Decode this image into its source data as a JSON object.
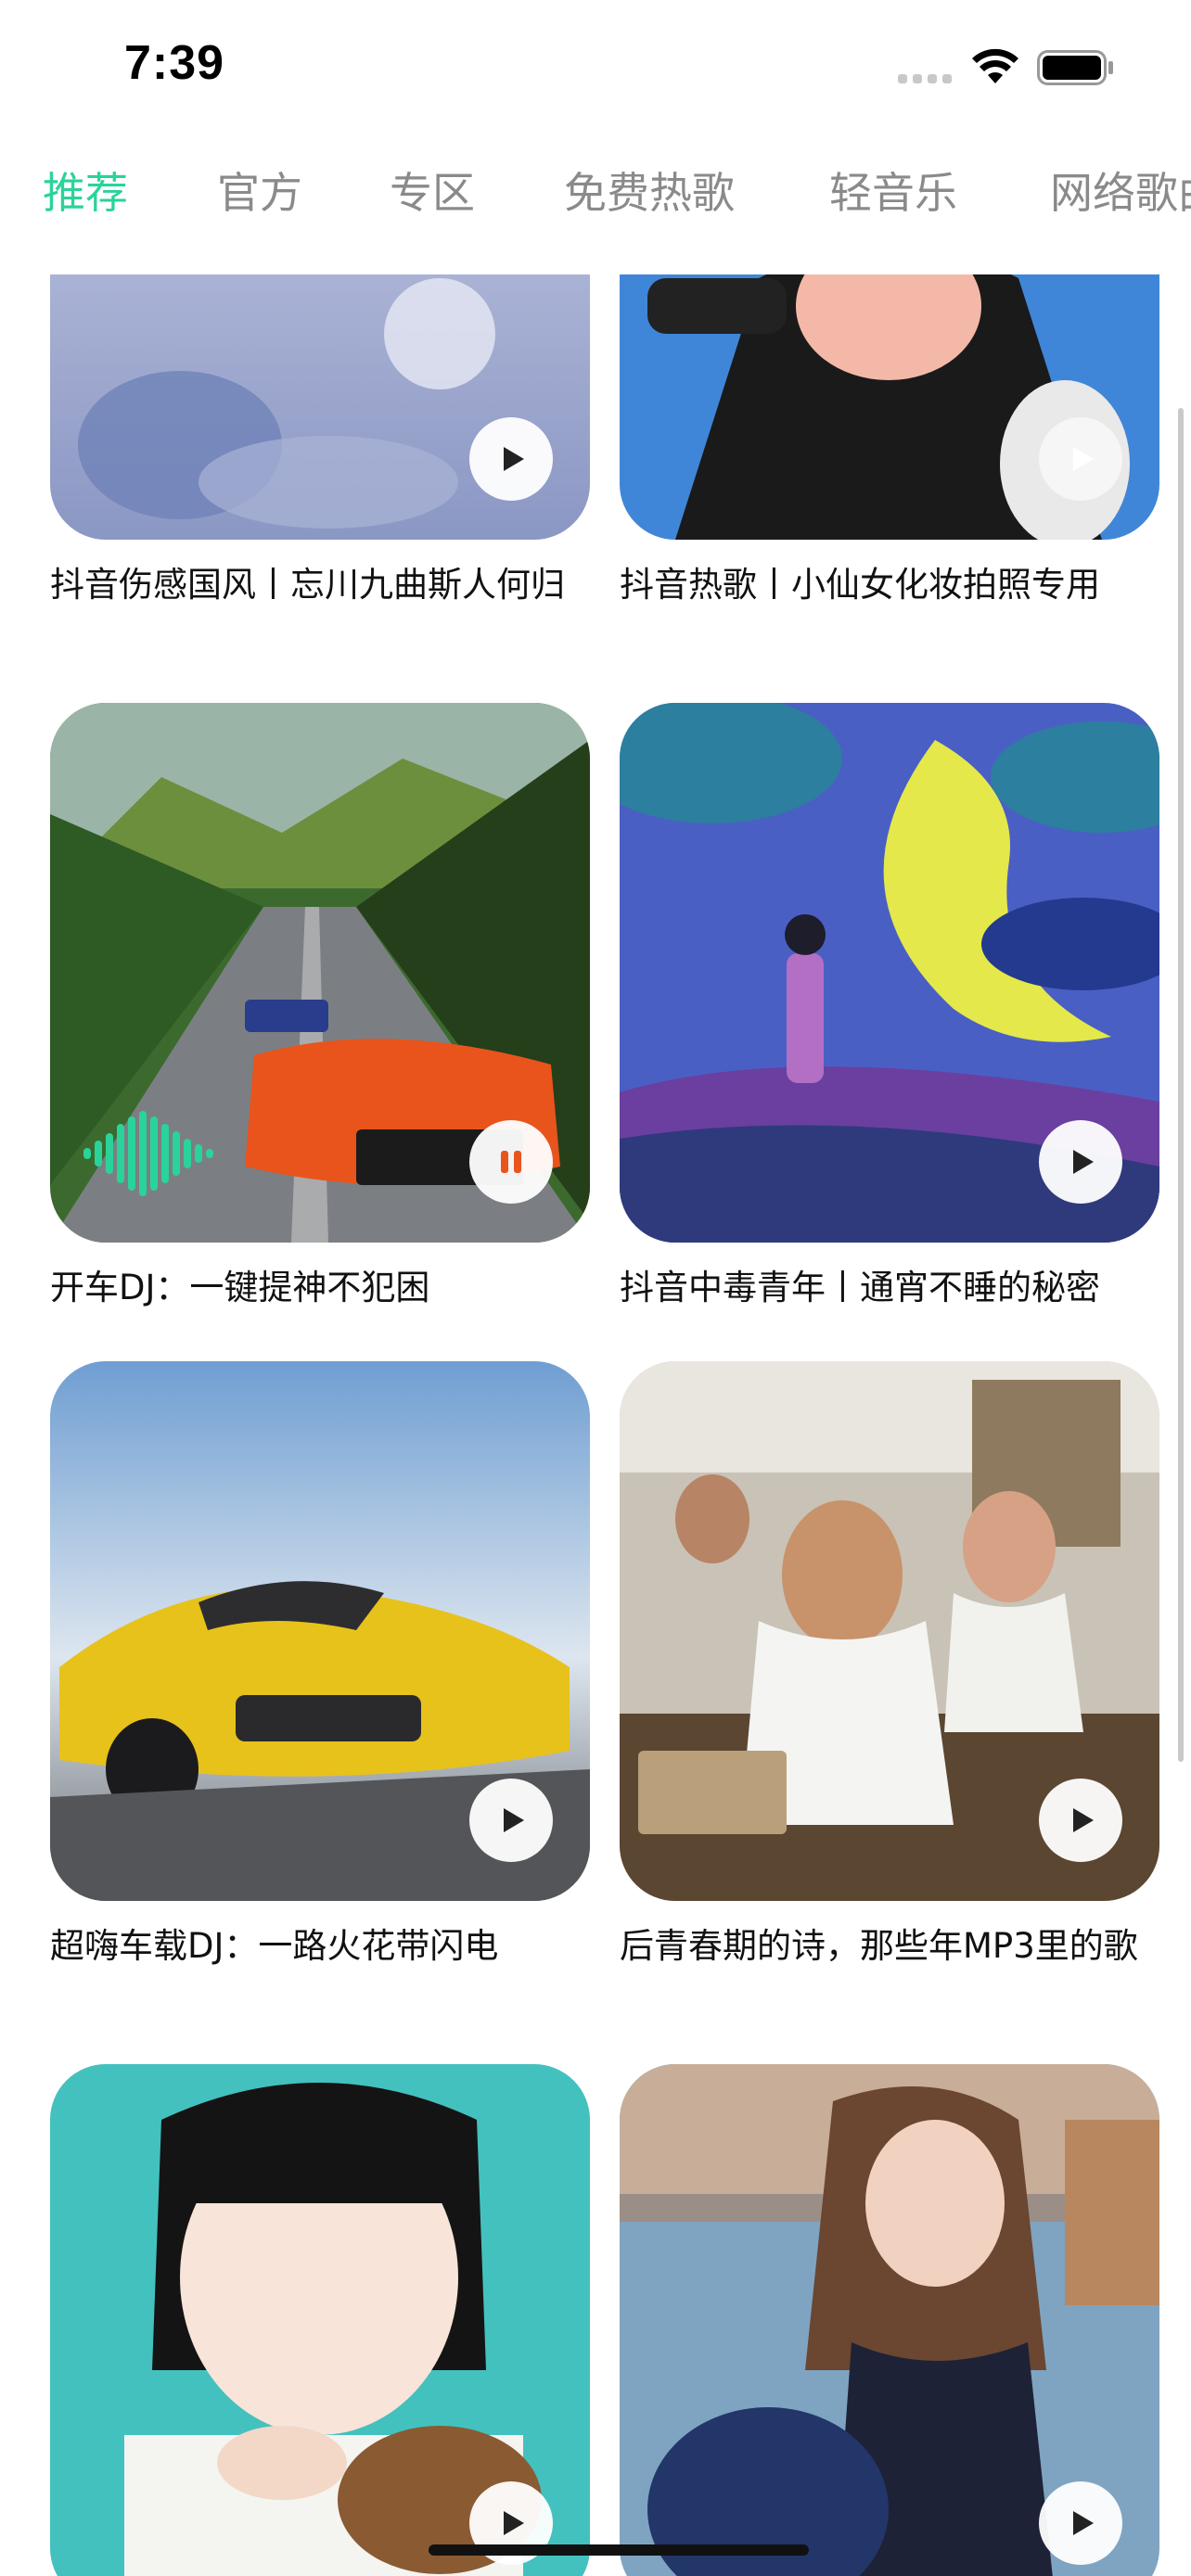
{
  "status": {
    "time": "7:39",
    "icons": [
      "signal-icon",
      "wifi-icon",
      "battery-icon"
    ]
  },
  "tabs": [
    {
      "label": "推荐",
      "active": true
    },
    {
      "label": "官方",
      "active": false
    },
    {
      "label": "专区",
      "active": false
    },
    {
      "label": "免费热歌",
      "active": false
    },
    {
      "label": "轻音乐",
      "active": false
    },
    {
      "label": "网络歌曲",
      "active": false
    }
  ],
  "colors": {
    "accent": "#2ad39a",
    "tab_inactive": "#8a8a8a",
    "text": "#111111"
  },
  "playlists": [
    {
      "title": "抖音伤感国风丨忘川九曲斯人何归",
      "state": "play",
      "icon": "play-icon"
    },
    {
      "title": "抖音热歌丨小仙女化妆拍照专用",
      "state": "play",
      "icon": "play-icon"
    },
    {
      "title": "开车DJ：一键提神不犯困",
      "state": "pause",
      "icon": "pause-icon"
    },
    {
      "title": "抖音中毒青年丨通宵不睡的秘密",
      "state": "play",
      "icon": "play-icon"
    },
    {
      "title": "超嗨车载DJ：一路火花带闪电",
      "state": "play",
      "icon": "play-icon"
    },
    {
      "title": "后青春期的诗，那些年MP3里的歌",
      "state": "play",
      "icon": "play-icon"
    },
    {
      "title": "",
      "state": "play",
      "icon": "play-icon"
    },
    {
      "title": "",
      "state": "play",
      "icon": "play-icon"
    }
  ]
}
